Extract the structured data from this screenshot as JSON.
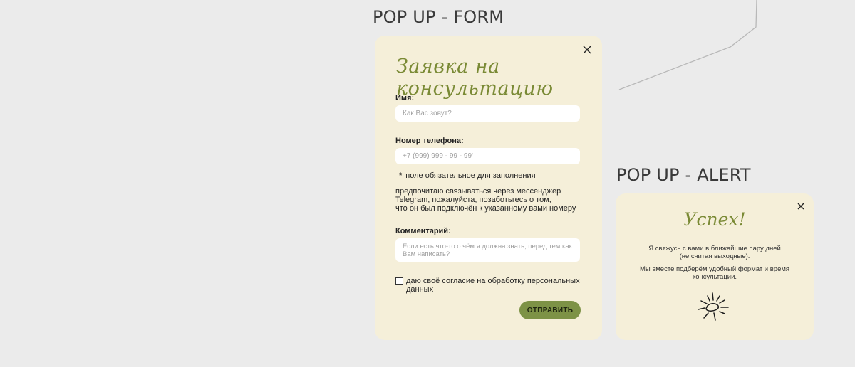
{
  "sections": {
    "form_title": "POP UP - FORM",
    "alert_title": "POP UP - ALERT"
  },
  "form": {
    "heading": "Заявка на консультацию",
    "name_label": "Имя:",
    "name_placeholder": "Как Вас зовут?",
    "phone_label": "Номер телефона:",
    "phone_placeholder": "+7 (999) 999 - 99 - 99'",
    "required_star": "*",
    "required_note": "поле обязательное для заполнения",
    "messenger_note_lines": [
      "предпочитаю связываться через мессенджер",
      "Telegram, пожалуйста, позаботьтесь о том,",
      "что он был подключён к указанному вами номеру"
    ],
    "comment_label": "Комментарий:",
    "comment_placeholder": "Если есть что-то о чём я должна знать, перед тем как Вам написать?",
    "consent_checked": false,
    "consent_text": "даю своё согласие на обработку персональных данных",
    "submit_label": "ОТПРАВИТЬ",
    "close_icon": "close-icon"
  },
  "alert": {
    "heading": "Успех!",
    "text1_lines": [
      "Я свяжусь с вами в ближайшие пару дней",
      "(не считая выходные)."
    ],
    "text2_lines": [
      "Мы вместе подберём удобный формат и время",
      "консультации."
    ],
    "icon": "sun-icon",
    "close_icon": "close-icon"
  },
  "colors": {
    "background": "#ebebeb",
    "card": "#f5efd9",
    "accent": "#7d9246",
    "script_title": "#7a8a35"
  }
}
